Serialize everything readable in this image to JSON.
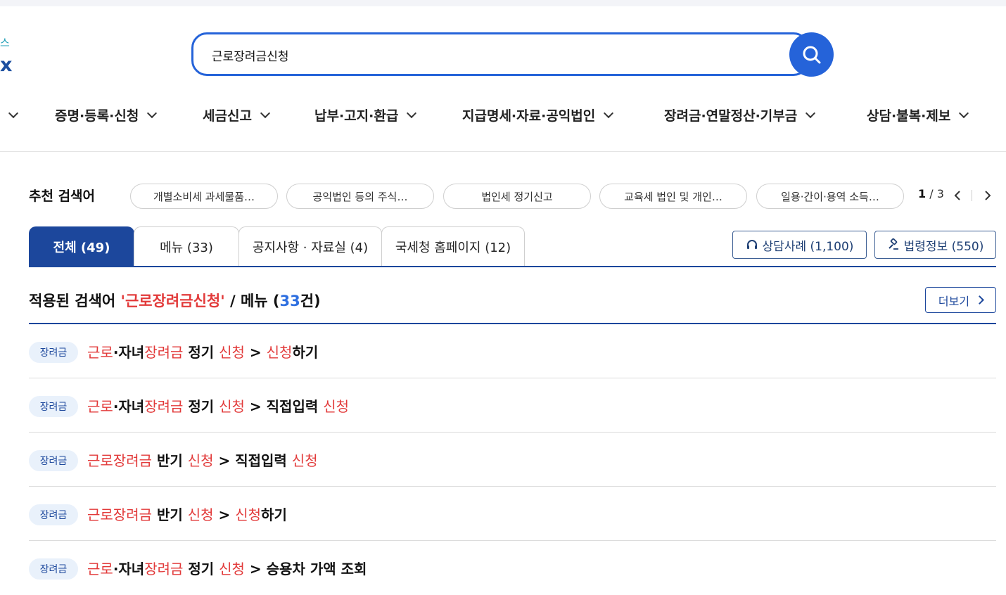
{
  "logo": {
    "top_fragment": "스",
    "bottom_fragment": "x"
  },
  "search": {
    "value": "근로장려금신청",
    "button_icon": "search-icon"
  },
  "nav": {
    "items": [
      {
        "label": ""
      },
      {
        "label": "증명·등록·신청"
      },
      {
        "label": "세금신고"
      },
      {
        "label": "납부·고지·환급"
      },
      {
        "label": "지급명세·자료·공익법인"
      },
      {
        "label": "장려금·연말정산·기부금"
      },
      {
        "label": "상담·불복·제보"
      }
    ]
  },
  "recommended": {
    "label": "추천 검색어",
    "chips": [
      "개별소비세 과세물품…",
      "공익법인 등의 주식…",
      "법인세 정기신고",
      "교육세 법인 및 개인…",
      "일용·간이·용역 소득…"
    ],
    "page_current": "1",
    "page_sep": " / ",
    "page_total": "3"
  },
  "tabs": [
    {
      "label": "전체 (49)",
      "active": true
    },
    {
      "label": "메뉴 (33)"
    },
    {
      "label": "공지사항 · 자료실 (4)"
    },
    {
      "label": "국세청 홈페이지 (12)"
    }
  ],
  "side_buttons": {
    "consult": {
      "label": "상담사례 (1,100)",
      "icon": "headset-icon"
    },
    "law": {
      "label": "법령정보 (550)",
      "icon": "gavel-icon"
    }
  },
  "section": {
    "prefix": "적용된 검색어 ",
    "keyword": "'근로장려금신청'",
    "middle": " / 메뉴 (",
    "count": "33",
    "suffix": "건)",
    "more_label": "더보기"
  },
  "results": [
    {
      "badge": "장려금",
      "parts": [
        [
          "근로",
          true
        ],
        [
          "·자녀",
          false
        ],
        [
          "장려금",
          true
        ],
        [
          " 정기 ",
          false
        ],
        [
          "신청",
          true
        ],
        [
          " > ",
          false
        ],
        [
          "신청",
          true
        ],
        [
          "하기",
          false
        ]
      ]
    },
    {
      "badge": "장려금",
      "parts": [
        [
          "근로",
          true
        ],
        [
          "·자녀",
          false
        ],
        [
          "장려금",
          true
        ],
        [
          " 정기 ",
          false
        ],
        [
          "신청",
          true
        ],
        [
          " > 직접입력 ",
          false
        ],
        [
          "신청",
          true
        ]
      ]
    },
    {
      "badge": "장려금",
      "parts": [
        [
          "근로장려금",
          true
        ],
        [
          " 반기 ",
          false
        ],
        [
          "신청",
          true
        ],
        [
          " > 직접입력 ",
          false
        ],
        [
          "신청",
          true
        ]
      ]
    },
    {
      "badge": "장려금",
      "parts": [
        [
          "근로장려금",
          true
        ],
        [
          " 반기 ",
          false
        ],
        [
          "신청",
          true
        ],
        [
          " > ",
          false
        ],
        [
          "신청",
          true
        ],
        [
          "하기",
          false
        ]
      ]
    },
    {
      "badge": "장려금",
      "parts": [
        [
          "근로",
          true
        ],
        [
          "·자녀",
          false
        ],
        [
          "장려금",
          true
        ],
        [
          " 정기 ",
          false
        ],
        [
          "신청",
          true
        ],
        [
          " > 승용차 가액 조회",
          false
        ]
      ]
    }
  ]
}
